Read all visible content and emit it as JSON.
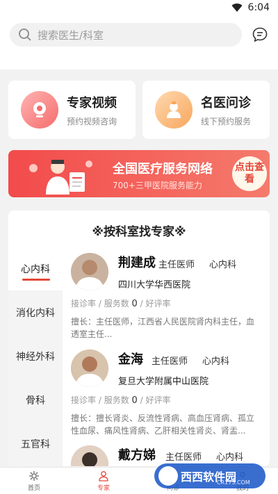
{
  "status_bar": {
    "time": "6:04"
  },
  "search": {
    "placeholder": "搜索医生/科室"
  },
  "cards": [
    {
      "title": "专家视频",
      "subtitle": "预约视频咨询",
      "icon": "video-camera-icon"
    },
    {
      "title": "名医问诊",
      "subtitle": "线下预约服务",
      "icon": "nurse-icon"
    }
  ],
  "banner": {
    "title": "全国医疗服务网络",
    "subtitle": "700+三甲医院服务能力",
    "button": "点击查看"
  },
  "section": {
    "title": "※按科室找专家※",
    "departments": [
      "心内科",
      "消化内科",
      "神经外科",
      "骨科",
      "五官科"
    ],
    "active_department": "心内科"
  },
  "doctors": [
    {
      "name": "荆建成",
      "title": "主任医师",
      "dept": "心内科",
      "hospital": "四川大学华西医院",
      "consult_rate": "接诊率",
      "service_label": "/ 服务数",
      "service_count": "0",
      "rating": "/ 好评率",
      "desc": "擅长：主任医师，江西省人民医院肾内科主任，血透室主任..."
    },
    {
      "name": "金海",
      "title": "主任医师",
      "dept": "心内科",
      "hospital": "复旦大学附属中山医院",
      "consult_rate": "接诊率",
      "service_label": "/ 服务数",
      "service_count": "0",
      "rating": "/ 好评率",
      "desc": "擅长：擅长肾炎、反流性肾病、高血压肾病、孤立性血尿、痛风性肾病、乙肝相关性肾炎、肾盂..."
    },
    {
      "name": "戴方娣",
      "title": "主任医师",
      "dept": "心内科"
    }
  ],
  "tabbar": [
    {
      "label": "首页",
      "icon": "home-icon"
    },
    {
      "label": "专家",
      "icon": "doctor-icon"
    },
    {
      "label": "问诊",
      "icon": "consult-icon"
    },
    {
      "label": "我的",
      "icon": "profile-icon"
    }
  ],
  "watermark": {
    "text": "西西软件园",
    "url": "CR173.COM"
  },
  "colors": {
    "accent": "#e3483b",
    "banner": "#f24b4b"
  }
}
